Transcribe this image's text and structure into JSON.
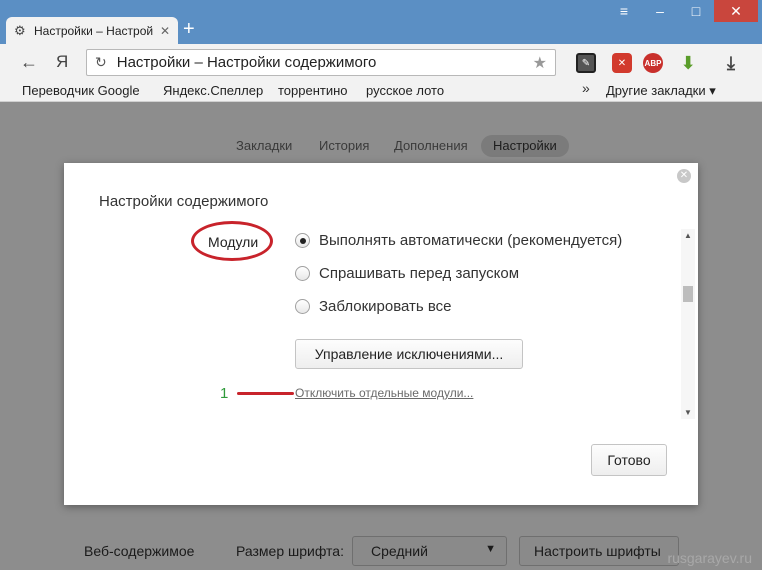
{
  "window": {
    "tab_title": "Настройки – Настрой",
    "tab_icon": "gear-icon",
    "new_tab": "+",
    "controls": {
      "menu": "≡",
      "minimize": "–",
      "maximize": "□",
      "close": "✕"
    }
  },
  "toolbar": {
    "back": "←",
    "yandex_button": "Я",
    "address": "Настройки – Настройки содержимого",
    "reload": "↻",
    "bookmark_star": "★",
    "extensions": [
      "ext-1-icon",
      "ext-2-icon",
      "ABP",
      "download-arrow-icon",
      "download-icon"
    ],
    "abp_label": "ABP"
  },
  "bookmarks_bar": {
    "items": [
      "Переводчик Google",
      "Яндекс.Спеллер",
      "торрентино",
      "русское лото"
    ],
    "more": "»",
    "other": "Другие закладки ▾"
  },
  "page": {
    "tabs": [
      {
        "label": "Закладки",
        "active": false
      },
      {
        "label": "История",
        "active": false
      },
      {
        "label": "Дополнения",
        "active": false
      },
      {
        "label": "Настройки",
        "active": true
      }
    ],
    "bottom": {
      "web_content_label": "Веб-содержимое",
      "font_size_label": "Размер шрифта:",
      "font_size_value": "Средний",
      "customize_fonts_button": "Настроить шрифты",
      "watermark": "rusgarayev.ru"
    }
  },
  "dialog": {
    "title": "Настройки содержимого",
    "close": "✕",
    "section_label": "Модули",
    "options": [
      {
        "label": "Выполнять автоматически (рекомендуется)",
        "checked": true
      },
      {
        "label": "Спрашивать перед запуском",
        "checked": false
      },
      {
        "label": "Заблокировать все",
        "checked": false
      }
    ],
    "manage_exceptions_button": "Управление исключениями...",
    "annotation_number": "1",
    "disable_modules_link": "Отключить отдельные модули...",
    "done_button": "Готово",
    "annotation_color": "#c8232b",
    "annotation_number_color": "#2f9a3a"
  }
}
